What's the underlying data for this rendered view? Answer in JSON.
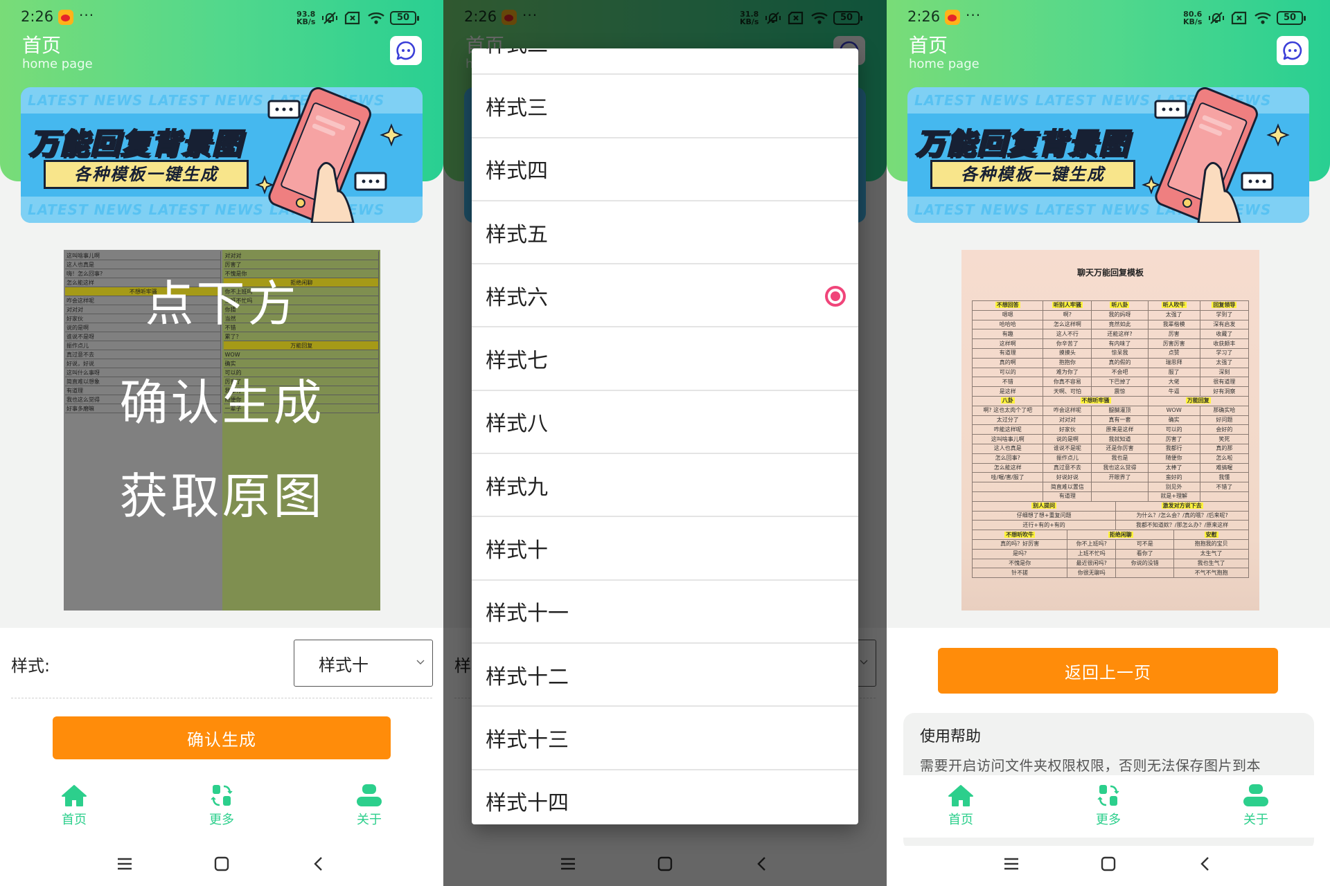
{
  "status_bars": [
    {
      "time": "2:26",
      "speed_value": "93.8",
      "speed_unit": "KB/s",
      "battery": "50"
    },
    {
      "time": "2:26",
      "speed_value": "31.8",
      "speed_unit": "KB/s",
      "battery": "50"
    },
    {
      "time": "2:26",
      "speed_value": "80.6",
      "speed_unit": "KB/s",
      "battery": "50"
    }
  ],
  "header": {
    "title": "首页",
    "subtitle": "home page"
  },
  "banner": {
    "stripe_text": "LATEST NEWS   LATEST NEWS   LATEST NEWS",
    "headline": "万能回复背景图",
    "tagline": "各种模板一键生成"
  },
  "preview_overlay": {
    "line1": "点下方",
    "line2": "确认生成",
    "line3": "获取原图"
  },
  "preview_left_rows": [
    "这叫啥事儿啊",
    "这人也真是",
    "嗨！怎么回事?",
    "怎么能这样",
    "不想听牢骚",
    "咋会这样呢",
    "对对对",
    "好家伙",
    "说的是啊",
    "谁说不是呀",
    "振作点儿",
    "真过意不去",
    "好说，好说",
    "这叫什么事呀",
    "简直难以想象",
    "有道理",
    "我也这么觉得",
    "好事多磨嘛"
  ],
  "preview_right_rows": [
    "对对对",
    "厉害了",
    "不愧是你",
    "拒绝闲聊",
    "你不上班吗",
    "上班不忙吗",
    "你猜",
    "当然",
    "不错",
    "累了？",
    "万能回复",
    "WOW",
    "确实",
    "可以的",
    "厉害了",
    "我都行",
    "随便你",
    "一辈子"
  ],
  "form": {
    "style_label": "样式:",
    "style_value": "样式十",
    "confirm_button": "确认生成"
  },
  "tabbar": {
    "items": [
      {
        "label": "首页",
        "icon": "home-icon"
      },
      {
        "label": "更多",
        "icon": "swap-grid-icon"
      },
      {
        "label": "关于",
        "icon": "user-icon"
      }
    ]
  },
  "dropdown": {
    "selected_index": 4,
    "options": [
      "样式二",
      "样式三",
      "样式四",
      "样式五",
      "样式六",
      "样式七",
      "样式八",
      "样式九",
      "样式十",
      "样式十一",
      "样式十二",
      "样式十三",
      "样式十四"
    ]
  },
  "result": {
    "template_title": "聊天万能回复模板",
    "back_button": "返回上一页",
    "help_title": "使用帮助",
    "help_text": "需要开启访问文件夹权限权限，否则无法保存图片到本"
  },
  "template_table": {
    "section1_headers": [
      "不想回答",
      "听别人牢骚",
      "听八卦",
      "听人吹牛",
      "回复领导"
    ],
    "section1_rows": [
      [
        "嗯嗯",
        "啊?",
        "我的妈呀",
        "太强了",
        "学到了"
      ],
      [
        "哈哈哈",
        "怎么这样啊",
        "竟然如此",
        "我辈楷模",
        "深有启发"
      ],
      [
        "有趣",
        "这人不行",
        "还能这样?",
        "厉害",
        "收藏了"
      ],
      [
        "这样啊",
        "你辛苦了",
        "有内味了",
        "厉害厉害",
        "收获颇丰"
      ],
      [
        "有道理",
        "摸摸头",
        "惊呆我",
        "点赞",
        "学习了"
      ],
      [
        "真的啊",
        "抱抱你",
        "真的假的",
        "瑞思拜",
        "太强了"
      ],
      [
        "可以的",
        "难为你了",
        "不会吧",
        "服了",
        "深刻"
      ],
      [
        "不错",
        "你真不容易",
        "下巴掉了",
        "大佬",
        "很有道理"
      ],
      [
        "是这样",
        "天啊、可怕",
        "震惊",
        "牛逼",
        "好有洞察"
      ]
    ],
    "section2_headers": [
      "八卦",
      "不想听牢骚",
      "万能回复"
    ],
    "section2_rows": [
      [
        "啊? 这也太肉个了吧",
        "咋会这样呢",
        "醍醐灌顶",
        "WOW",
        "那确实哈"
      ],
      [
        "太过分了",
        "对对对",
        "真有一套",
        "确实",
        "好问题"
      ],
      [
        "咋能这样呢",
        "好家伙",
        "原来是这样",
        "可以的",
        "会好的"
      ],
      [
        "这叫啥事儿啊",
        "说的是啊",
        "我就知道",
        "厉害了",
        "笑死"
      ],
      [
        "这人也真是",
        "谁说不是呢",
        "还是你厉害",
        "我都行",
        "真的那"
      ],
      [
        "怎么回事?",
        "振作点儿",
        "我也是",
        "随便你",
        "怎么啦"
      ],
      [
        "怎么能这样",
        "真过意不去",
        "我也这么觉得",
        "太棒了",
        "难搞喔"
      ],
      [
        "哇/喔/害/服了",
        "好说好说",
        "开眼界了",
        "蛮好的",
        "我懂"
      ],
      [
        "",
        "简直难以置信",
        "",
        "别见外",
        "不错了"
      ],
      [
        "",
        "有道理",
        "",
        "就是+理解",
        ""
      ]
    ],
    "section3_headers": [
      "别人提问",
      "激发对方说下去"
    ],
    "section3_rows": [
      [
        "仔细想了想+重复问题",
        "为什么？/怎么会？/真的哦？/后来呢?"
      ],
      [
        "还行+有的+有的",
        "我都不知道欸？/那怎么办？/原来这样"
      ]
    ],
    "section4_headers": [
      "不想听吹牛",
      "拒绝闲聊",
      "安慰"
    ],
    "section4_rows": [
      [
        "真的吗？好厉害",
        "你不上班吗?",
        "可不是",
        "抱抱我的宝贝"
      ],
      [
        "是吗?",
        "上班不忙吗",
        "看你了",
        "太生气了"
      ],
      [
        "不愧是你",
        "最近很闲吗?",
        "你说的没错",
        "我也生气了"
      ],
      [
        "针不搓",
        "你很无聊吗",
        "",
        "不气不气抱抱"
      ]
    ]
  },
  "colors": {
    "brand_green": "#2ccf8c",
    "orange_button": "#ff8c0a",
    "radio_pink": "#f0457a",
    "chat_icon_blue": "#3b3fd8"
  }
}
